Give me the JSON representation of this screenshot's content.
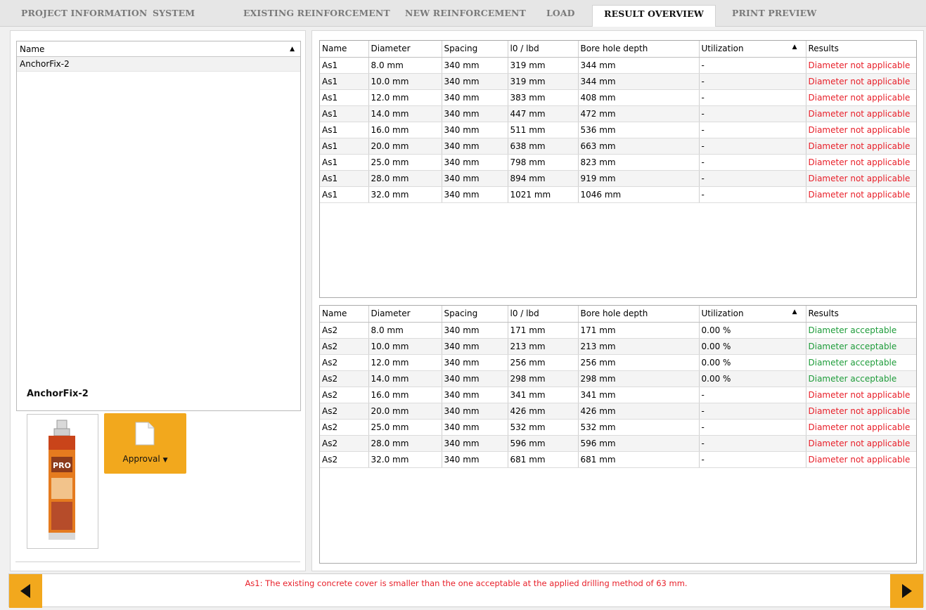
{
  "tabs": [
    {
      "label": "PROJECT INFORMATION",
      "active": false
    },
    {
      "label": "SYSTEM",
      "active": false
    },
    {
      "label": "EXISTING REINFORCEMENT",
      "active": false
    },
    {
      "label": "NEW REINFORCEMENT",
      "active": false
    },
    {
      "label": "LOAD",
      "active": false
    },
    {
      "label": "RESULT OVERVIEW",
      "active": true
    },
    {
      "label": "PRINT PREVIEW",
      "active": false
    }
  ],
  "name_list": {
    "header": "Name",
    "items": [
      "AnchorFix-2"
    ]
  },
  "product": {
    "title": "AnchorFix-2",
    "approval_label": "Approval",
    "thumb_icon": "adhesive-cartridge-image"
  },
  "tables": {
    "columns": [
      "Name",
      "Diameter",
      "Spacing",
      "l0 / lbd",
      "Bore hole depth",
      "Utilization",
      "Results"
    ],
    "top_rows": [
      [
        "As1",
        "8.0 mm",
        "340 mm",
        "319 mm",
        "344 mm",
        "-",
        "Diameter not applicable"
      ],
      [
        "As1",
        "10.0 mm",
        "340 mm",
        "319 mm",
        "344 mm",
        "-",
        "Diameter not applicable"
      ],
      [
        "As1",
        "12.0 mm",
        "340 mm",
        "383 mm",
        "408 mm",
        "-",
        "Diameter not applicable"
      ],
      [
        "As1",
        "14.0 mm",
        "340 mm",
        "447 mm",
        "472 mm",
        "-",
        "Diameter not applicable"
      ],
      [
        "As1",
        "16.0 mm",
        "340 mm",
        "511 mm",
        "536 mm",
        "-",
        "Diameter not applicable"
      ],
      [
        "As1",
        "20.0 mm",
        "340 mm",
        "638 mm",
        "663 mm",
        "-",
        "Diameter not applicable"
      ],
      [
        "As1",
        "25.0 mm",
        "340 mm",
        "798 mm",
        "823 mm",
        "-",
        "Diameter not applicable"
      ],
      [
        "As1",
        "28.0 mm",
        "340 mm",
        "894 mm",
        "919 mm",
        "-",
        "Diameter not applicable"
      ],
      [
        "As1",
        "32.0 mm",
        "340 mm",
        "1021 mm",
        "1046 mm",
        "-",
        "Diameter not applicable"
      ]
    ],
    "bottom_rows": [
      [
        "As2",
        "8.0 mm",
        "340 mm",
        "171 mm",
        "171 mm",
        "0.00 %",
        "Diameter acceptable"
      ],
      [
        "As2",
        "10.0 mm",
        "340 mm",
        "213 mm",
        "213 mm",
        "0.00 %",
        "Diameter acceptable"
      ],
      [
        "As2",
        "12.0 mm",
        "340 mm",
        "256 mm",
        "256 mm",
        "0.00 %",
        "Diameter acceptable"
      ],
      [
        "As2",
        "14.0 mm",
        "340 mm",
        "298 mm",
        "298 mm",
        "0.00 %",
        "Diameter acceptable"
      ],
      [
        "As2",
        "16.0 mm",
        "340 mm",
        "341 mm",
        "341 mm",
        "-",
        "Diameter not applicable"
      ],
      [
        "As2",
        "20.0 mm",
        "340 mm",
        "426 mm",
        "426 mm",
        "-",
        "Diameter not applicable"
      ],
      [
        "As2",
        "25.0 mm",
        "340 mm",
        "532 mm",
        "532 mm",
        "-",
        "Diameter not applicable"
      ],
      [
        "As2",
        "28.0 mm",
        "340 mm",
        "596 mm",
        "596 mm",
        "-",
        "Diameter not applicable"
      ],
      [
        "As2",
        "32.0 mm",
        "340 mm",
        "681 mm",
        "681 mm",
        "-",
        "Diameter not applicable"
      ]
    ]
  },
  "message": "As1: The existing concrete cover is smaller than the one acceptable at the applied drilling method of 63 mm.",
  "colors": {
    "accent": "#f2a81d",
    "error": "#e8202a",
    "ok": "#1e9c3a"
  }
}
